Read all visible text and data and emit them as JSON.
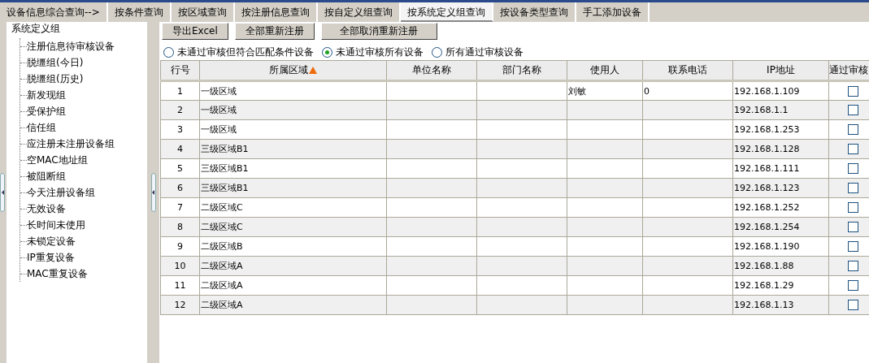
{
  "tabs": [
    {
      "label": "设备信息综合查询-->",
      "selected": false
    },
    {
      "label": "按条件查询",
      "selected": false
    },
    {
      "label": "按区域查询",
      "selected": false
    },
    {
      "label": "按注册信息查询",
      "selected": false
    },
    {
      "label": "按自定义组查询",
      "selected": false
    },
    {
      "label": "按系统定义组查询",
      "selected": true
    },
    {
      "label": "按设备类型查询",
      "selected": false
    },
    {
      "label": "手工添加设备",
      "selected": false
    }
  ],
  "tree": {
    "label": "系统定义组",
    "children": [
      {
        "label": "注册信息待审核设备"
      },
      {
        "label": "脱缰组(今日)"
      },
      {
        "label": "脱缰组(历史)"
      },
      {
        "label": "新发现组"
      },
      {
        "label": "受保护组"
      },
      {
        "label": "信任组"
      },
      {
        "label": "应注册未注册设备组"
      },
      {
        "label": "空MAC地址组"
      },
      {
        "label": "被阻断组"
      },
      {
        "label": "今天注册设备组"
      },
      {
        "label": "无效设备"
      },
      {
        "label": "长时间未使用"
      },
      {
        "label": "未锁定设备"
      },
      {
        "label": "IP重复设备"
      },
      {
        "label": "MAC重复设备"
      }
    ]
  },
  "buttons": [
    "导出Excel",
    "全部重新注册",
    "全部取消重新注册"
  ],
  "filters": [
    {
      "label": "未通过审核但符合匹配条件设备",
      "selected": false
    },
    {
      "label": "未通过审核所有设备",
      "selected": true
    },
    {
      "label": "所有通过审核设备",
      "selected": false
    }
  ],
  "table": {
    "columns": [
      {
        "label": "行号",
        "sorted": false
      },
      {
        "label": "所属区域",
        "sorted": true
      },
      {
        "label": "单位名称",
        "sorted": false
      },
      {
        "label": "部门名称",
        "sorted": false
      },
      {
        "label": "使用人",
        "sorted": false
      },
      {
        "label": "联系电话",
        "sorted": false
      },
      {
        "label": "IP地址",
        "sorted": false
      },
      {
        "label": "通过审核",
        "sorted": false
      }
    ],
    "rows": [
      {
        "no": "1",
        "region": "一级区域",
        "unit": "",
        "dept": "",
        "user": "刘敏",
        "phone": "0",
        "ip": "192.168.1.109",
        "approved": false
      },
      {
        "no": "2",
        "region": "一级区域",
        "unit": "",
        "dept": "",
        "user": "",
        "phone": "",
        "ip": "192.168.1.1",
        "approved": false
      },
      {
        "no": "3",
        "region": "一级区域",
        "unit": "",
        "dept": "",
        "user": "",
        "phone": "",
        "ip": "192.168.1.253",
        "approved": false
      },
      {
        "no": "4",
        "region": "三级区域B1",
        "unit": "",
        "dept": "",
        "user": "",
        "phone": "",
        "ip": "192.168.1.128",
        "approved": false
      },
      {
        "no": "5",
        "region": "三级区域B1",
        "unit": "",
        "dept": "",
        "user": "",
        "phone": "",
        "ip": "192.168.1.111",
        "approved": false
      },
      {
        "no": "6",
        "region": "三级区域B1",
        "unit": "",
        "dept": "",
        "user": "",
        "phone": "",
        "ip": "192.168.1.123",
        "approved": false
      },
      {
        "no": "7",
        "region": "二级区域C",
        "unit": "",
        "dept": "",
        "user": "",
        "phone": "",
        "ip": "192.168.1.252",
        "approved": false
      },
      {
        "no": "8",
        "region": "二级区域C",
        "unit": "",
        "dept": "",
        "user": "",
        "phone": "",
        "ip": "192.168.1.254",
        "approved": false
      },
      {
        "no": "9",
        "region": "二级区域B",
        "unit": "",
        "dept": "",
        "user": "",
        "phone": "",
        "ip": "192.168.1.190",
        "approved": false
      },
      {
        "no": "10",
        "region": "二级区域A",
        "unit": "",
        "dept": "",
        "user": "",
        "phone": "",
        "ip": "192.168.1.88",
        "approved": false
      },
      {
        "no": "11",
        "region": "二级区域A",
        "unit": "",
        "dept": "",
        "user": "",
        "phone": "",
        "ip": "192.168.1.29",
        "approved": false
      },
      {
        "no": "12",
        "region": "二级区域A",
        "unit": "",
        "dept": "",
        "user": "",
        "phone": "",
        "ip": "192.168.1.13",
        "approved": false
      }
    ]
  }
}
